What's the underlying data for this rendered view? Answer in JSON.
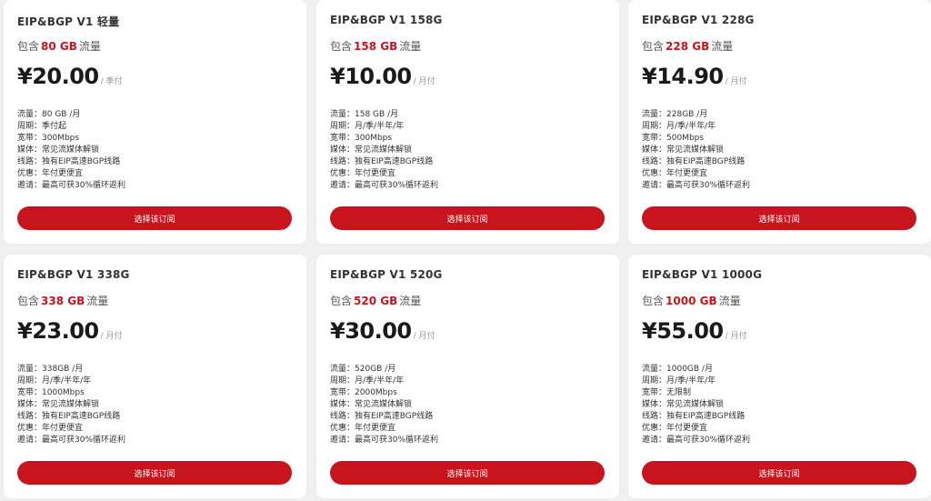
{
  "colors": {
    "accent": "#c8141c",
    "card_bg": "#ffffff",
    "page_bg": "#f0f0f0"
  },
  "plans": [
    {
      "title": "EIP&BGP V1 轻量",
      "traffic_prefix": "包含",
      "traffic_amount": "80 GB",
      "traffic_suffix": "流量",
      "price": "¥20.00",
      "period": "/ 季付",
      "specs": [
        {
          "label": "流量：",
          "value": "80 GB /月"
        },
        {
          "label": "周期：",
          "value": "季付起"
        },
        {
          "label": "宽带：",
          "value": "300Mbps"
        },
        {
          "label": "媒体：",
          "value": "常见流媒体解锁"
        },
        {
          "label": "线路：",
          "value": "独有EIP高速BGP线路"
        },
        {
          "label": "优惠：",
          "value": "年付更便宜"
        },
        {
          "label": "邀请：",
          "value": "最高可获30%循环返利"
        }
      ],
      "button_label": "选择该订阅"
    },
    {
      "title": "EIP&BGP V1 158G",
      "traffic_prefix": "包含",
      "traffic_amount": "158 GB",
      "traffic_suffix": "流量",
      "price": "¥10.00",
      "period": "/ 月付",
      "specs": [
        {
          "label": "流量：",
          "value": "158 GB /月"
        },
        {
          "label": "周期：",
          "value": "月/季/半年/年"
        },
        {
          "label": "宽带：",
          "value": "300Mbps"
        },
        {
          "label": "媒体：",
          "value": "常见流媒体解锁"
        },
        {
          "label": "线路：",
          "value": "独有EIP高速BGP线路"
        },
        {
          "label": "优惠：",
          "value": "年付更便宜"
        },
        {
          "label": "邀请：",
          "value": "最高可获30%循环返利"
        }
      ],
      "button_label": "选择该订阅"
    },
    {
      "title": "EIP&BGP V1 228G",
      "traffic_prefix": "包含",
      "traffic_amount": "228 GB",
      "traffic_suffix": "流量",
      "price": "¥14.90",
      "period": "/ 月付",
      "specs": [
        {
          "label": "流量：",
          "value": "228GB /月"
        },
        {
          "label": "周期：",
          "value": "月/季/半年/年"
        },
        {
          "label": "宽带：",
          "value": "500Mbps"
        },
        {
          "label": "媒体：",
          "value": "常见流媒体解锁"
        },
        {
          "label": "线路：",
          "value": "独有EIP高速BGP线路"
        },
        {
          "label": "优惠：",
          "value": "年付更便宜"
        },
        {
          "label": "邀请：",
          "value": "最高可获30%循环返利"
        }
      ],
      "button_label": "选择该订阅"
    },
    {
      "title": "EIP&BGP V1 338G",
      "traffic_prefix": "包含",
      "traffic_amount": "338 GB",
      "traffic_suffix": "流量",
      "price": "¥23.00",
      "period": "/ 月付",
      "specs": [
        {
          "label": "流量：",
          "value": "338GB /月"
        },
        {
          "label": "周期：",
          "value": "月/季/半年/年"
        },
        {
          "label": "宽带：",
          "value": "1000Mbps"
        },
        {
          "label": "媒体：",
          "value": "常见流媒体解锁"
        },
        {
          "label": "线路：",
          "value": "独有EIP高速BGP线路"
        },
        {
          "label": "优惠：",
          "value": "年付更便宜"
        },
        {
          "label": "邀请：",
          "value": "最高可获30%循环返利"
        }
      ],
      "button_label": "选择该订阅"
    },
    {
      "title": "EIP&BGP V1 520G",
      "traffic_prefix": "包含",
      "traffic_amount": "520 GB",
      "traffic_suffix": "流量",
      "price": "¥30.00",
      "period": "/ 月付",
      "specs": [
        {
          "label": "流量：",
          "value": "520GB /月"
        },
        {
          "label": "周期：",
          "value": "月/季/半年/年"
        },
        {
          "label": "宽带：",
          "value": "2000Mbps"
        },
        {
          "label": "媒体：",
          "value": "常见流媒体解锁"
        },
        {
          "label": "线路：",
          "value": "独有EIP高速BGP线路"
        },
        {
          "label": "优惠：",
          "value": "年付更便宜"
        },
        {
          "label": "邀请：",
          "value": "最高可获30%循环返利"
        }
      ],
      "button_label": "选择该订阅"
    },
    {
      "title": "EIP&BGP V1 1000G",
      "traffic_prefix": "包含",
      "traffic_amount": "1000 GB",
      "traffic_suffix": "流量",
      "price": "¥55.00",
      "period": "/ 月付",
      "specs": [
        {
          "label": "流量：",
          "value": "1000GB /月"
        },
        {
          "label": "周期：",
          "value": "月/季/半年/年"
        },
        {
          "label": "宽带：",
          "value": "无限制"
        },
        {
          "label": "媒体：",
          "value": "常见流媒体解锁"
        },
        {
          "label": "线路：",
          "value": "独有EIP高速BGP线路"
        },
        {
          "label": "优惠：",
          "value": "年付更便宜"
        },
        {
          "label": "邀请：",
          "value": "最高可获30%循环返利"
        }
      ],
      "button_label": "选择该订阅"
    }
  ]
}
